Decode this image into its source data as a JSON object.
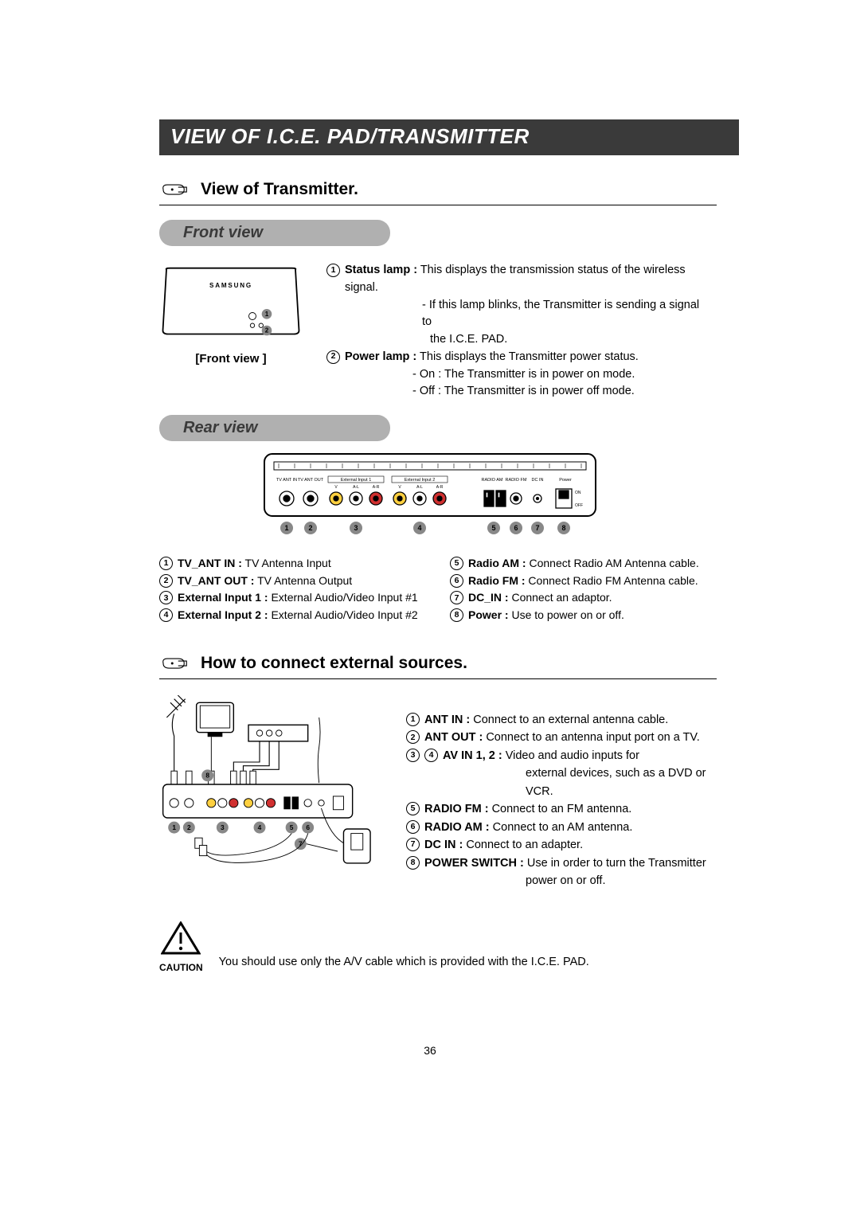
{
  "title": "VIEW OF I.C.E. PAD/TRANSMITTER",
  "section1": "View of Transmitter.",
  "pill_front": "Front view",
  "pill_rear": "Rear view",
  "front_caption": "[Front view ]",
  "front_items": {
    "i1": {
      "label": "Status lamp :",
      "text": " This displays the transmission status of the wireless signal.",
      "sub1": "- If this lamp blinks, the Transmitter is sending a signal to",
      "sub2": "the I.C.E. PAD."
    },
    "i2": {
      "label": "Power lamp :",
      "text": " This displays the Transmitter power status.",
      "sub1": "- On : The Transmitter is in power on mode.",
      "sub2": "- Off : The Transmitter is in power off mode."
    }
  },
  "rear_left": {
    "r1": {
      "label": "TV_ANT IN :",
      "text": " TV Antenna Input"
    },
    "r2": {
      "label": "TV_ANT OUT :",
      "text": " TV Antenna Output"
    },
    "r3": {
      "label": "External Input 1 :",
      "text": " External Audio/Video Input #1"
    },
    "r4": {
      "label": "External Input 2 :",
      "text": " External Audio/Video Input #2"
    }
  },
  "rear_right": {
    "r5": {
      "label": "Radio AM :",
      "text": " Connect Radio AM Antenna cable."
    },
    "r6": {
      "label": "Radio FM :",
      "text": " Connect Radio FM Antenna cable."
    },
    "r7": {
      "label": "DC_IN :",
      "text": " Connect an adaptor."
    },
    "r8": {
      "label": "Power :",
      "text": " Use to power on or off."
    }
  },
  "section2": "How to connect external sources.",
  "connect": {
    "c1": {
      "label": "ANT IN :",
      "text": " Connect to an external antenna cable."
    },
    "c2": {
      "label": "ANT OUT :",
      "text": " Connect to an antenna input port on a TV."
    },
    "c34": {
      "label": "AV IN 1, 2 :",
      "text": " Video and audio inputs for",
      "sub": "external devices, such as a DVD or VCR."
    },
    "c5": {
      "label": "RADIO FM :",
      "text": " Connect to an FM antenna."
    },
    "c6": {
      "label": "RADIO AM :",
      "text": " Connect to an AM antenna."
    },
    "c7": {
      "label": "DC IN :",
      "text": " Connect to an adapter."
    },
    "c8": {
      "label": "POWER SWITCH :",
      "text": " Use in order to turn the Transmitter",
      "sub": "power on or off."
    }
  },
  "caution": {
    "label": "CAUTION",
    "text": "You should use only the A/V cable which is provided with the I.C.E. PAD."
  },
  "page_number": "36",
  "device_brand": "SAMSUNG",
  "rear_labels": {
    "l1": "TV ANT IN",
    "l2": "TV ANT OUT",
    "l3": "External Input 1",
    "l4": "External Input 2",
    "l5": "RADIO AM",
    "l6": "RADIO FM",
    "l7": "DC IN",
    "l8": "Power",
    "on": "ON",
    "off": "OFF",
    "v": "V",
    "al": "A-L",
    "ar": "A-R"
  }
}
